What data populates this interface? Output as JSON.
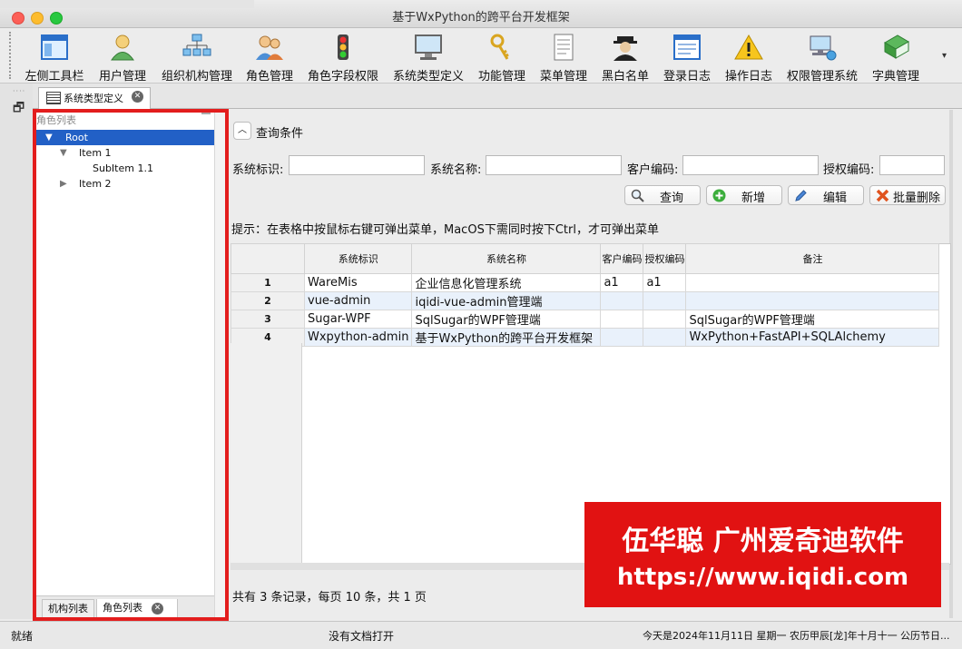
{
  "window": {
    "title": "基于WxPython的跨平台开发框架"
  },
  "toolbar": {
    "items": [
      {
        "label": "左侧工具栏",
        "icon": "window-layout-icon"
      },
      {
        "label": "用户管理",
        "icon": "user-icon"
      },
      {
        "label": "组织机构管理",
        "icon": "org-chart-icon"
      },
      {
        "label": "角色管理",
        "icon": "users-group-icon"
      },
      {
        "label": "角色字段权限",
        "icon": "traffic-light-icon"
      },
      {
        "label": "系统类型定义",
        "icon": "monitor-icon"
      },
      {
        "label": "功能管理",
        "icon": "keys-icon"
      },
      {
        "label": "菜单管理",
        "icon": "menu-document-icon"
      },
      {
        "label": "黑白名单",
        "icon": "spy-icon"
      },
      {
        "label": "登录日志",
        "icon": "log-window-icon"
      },
      {
        "label": "操作日志",
        "icon": "warning-icon"
      },
      {
        "label": "权限管理系统",
        "icon": "network-computer-icon"
      },
      {
        "label": "字典管理",
        "icon": "green-book-icon"
      }
    ]
  },
  "tabs": {
    "active": "系统类型定义"
  },
  "left_panel": {
    "caption": "角色列表",
    "tree": {
      "root": "Root",
      "item1": "Item 1",
      "subitem": "SubItem 1.1",
      "item2": "Item 2"
    },
    "bottom_tabs": {
      "tab1": "机构列表",
      "tab2": "角色列表"
    }
  },
  "query": {
    "toggle_label": "查询条件",
    "fields": {
      "system_id": {
        "label": "系统标识:",
        "value": ""
      },
      "system_name": {
        "label": "系统名称:",
        "value": ""
      },
      "customer_code": {
        "label": "客户编码:",
        "value": ""
      },
      "auth_code": {
        "label": "授权编码:",
        "value": ""
      }
    },
    "buttons": {
      "search": "查询",
      "add": "新增",
      "edit": "编辑",
      "batch_delete": "批量删除"
    },
    "hint": "提示：在表格中按鼠标右键可弹出菜单，MacOS下需同时按下Ctrl，才可弹出菜单"
  },
  "table": {
    "columns": [
      "系统标识",
      "系统名称",
      "客户编码",
      "授权编码",
      "备注"
    ],
    "rows": [
      [
        "1",
        "WareMis",
        "企业信息化管理系统",
        "a1",
        "a1",
        ""
      ],
      [
        "2",
        "vue-admin",
        "iqidi-vue-admin管理端",
        "",
        "",
        ""
      ],
      [
        "3",
        "Sugar-WPF",
        "SqlSugar的WPF管理端",
        "",
        "",
        "SqlSugar的WPF管理端"
      ],
      [
        "4",
        "Wxpython-admin",
        "基于WxPython的跨平台开发框架",
        "",
        "",
        "WxPython+FastAPI+SQLAlchemy"
      ]
    ]
  },
  "pager": {
    "text": "共有 3 条记录，每页 10 条，共 1 页"
  },
  "watermark": {
    "line1": "伍华聪 广州爱奇迪软件",
    "line2": "https://www.iqidi.com"
  },
  "status": {
    "left": "就绪",
    "center": "没有文档打开",
    "right": "今天是2024年11月11日 星期一 农历甲辰[龙]年十月十一 公历节日..."
  },
  "colors": {
    "selection": "#2260c6",
    "highlight_box": "#e31d1d",
    "watermark_bg": "#e11212"
  }
}
